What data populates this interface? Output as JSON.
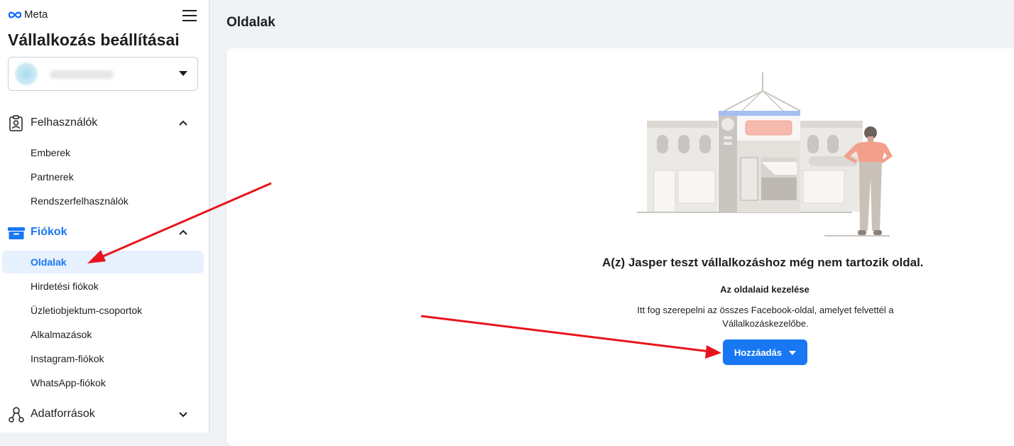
{
  "brand": {
    "name": "Meta"
  },
  "sidebar": {
    "heading": "Vállalkozás beállításai",
    "business_selector": {
      "name": ""
    },
    "sections": [
      {
        "label": "Felhasználók",
        "icon": "users-badge-icon",
        "expanded": true,
        "items": [
          {
            "label": "Emberek"
          },
          {
            "label": "Partnerek"
          },
          {
            "label": "Rendszerfelhasználók"
          }
        ]
      },
      {
        "label": "Fiókok",
        "icon": "accounts-folder-icon",
        "expanded": true,
        "active": true,
        "items": [
          {
            "label": "Oldalak",
            "selected": true
          },
          {
            "label": "Hirdetési fiókok"
          },
          {
            "label": "Üzletiobjektum-csoportok"
          },
          {
            "label": "Alkalmazások"
          },
          {
            "label": "Instagram-fiókok"
          },
          {
            "label": "WhatsApp-fiókok"
          }
        ]
      },
      {
        "label": "Adatforrások",
        "icon": "data-sources-icon",
        "expanded": false,
        "items": []
      }
    ]
  },
  "main": {
    "title": "Oldalak",
    "empty_state": {
      "title": "A(z) Jasper teszt vállalkozáshoz még nem tartozik oldal.",
      "subtitle": "Az oldalaid kezelése",
      "description": "Itt fog szerepelni az összes Facebook-oldal, amelyet felvettél a Vállalkozáskezelőbe.",
      "add_button_label": "Hozzáadás"
    }
  },
  "colors": {
    "accent": "#1877f2",
    "annotation_arrow": "#e8141c",
    "selected_bg": "#e7f0fd",
    "page_bg": "#f0f2f5"
  }
}
